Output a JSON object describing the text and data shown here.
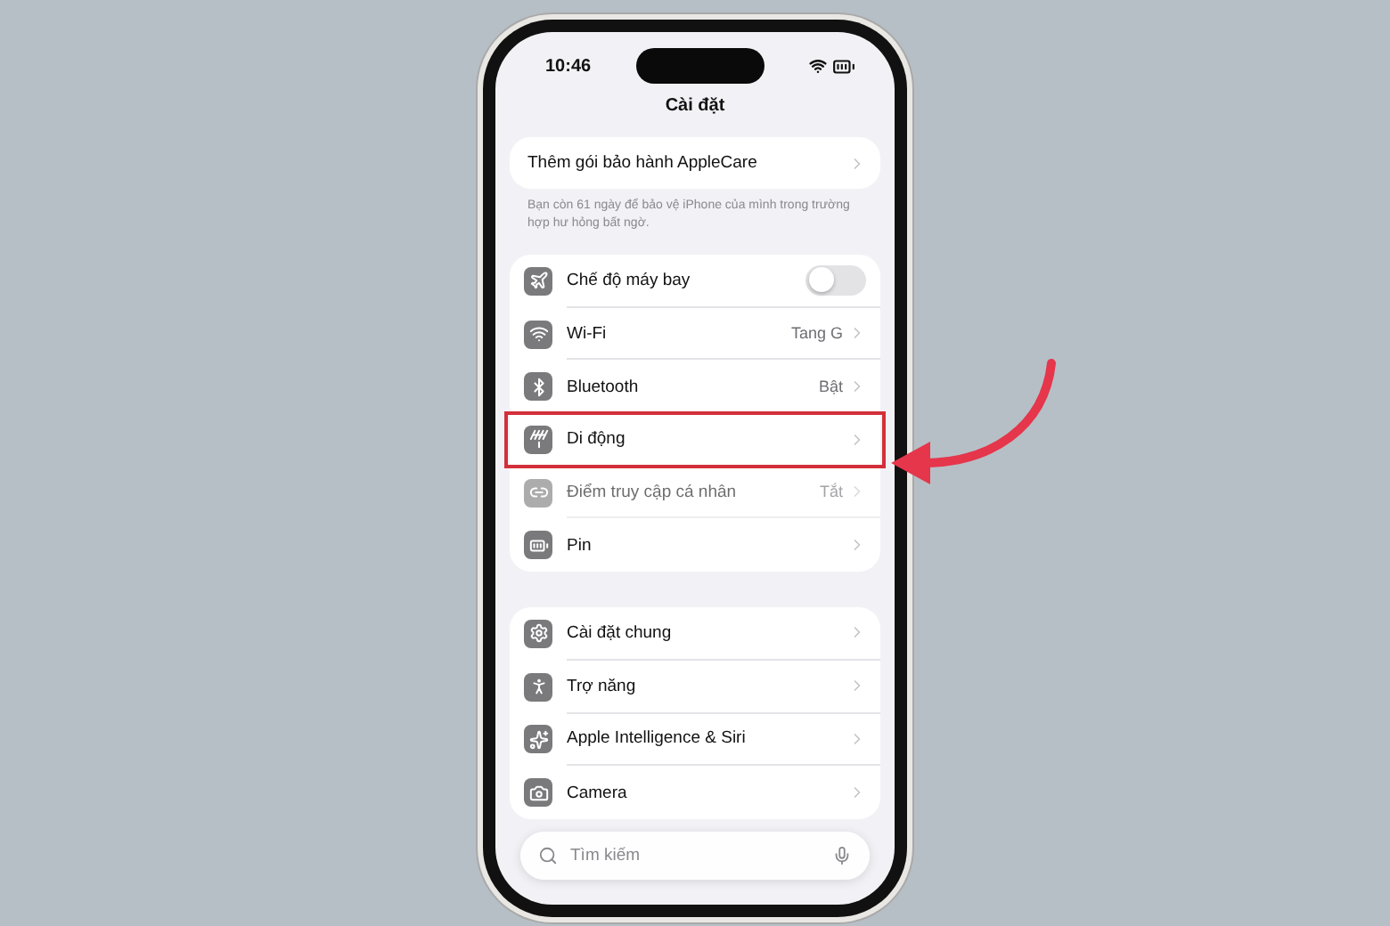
{
  "status_bar": {
    "time": "10:46"
  },
  "title": "Cài đặt",
  "applecare": {
    "label": "Thêm gói bảo hành AppleCare",
    "note": "Bạn còn 61 ngày để bảo vệ iPhone của mình trong trường hợp hư hỏng bất ngờ."
  },
  "groups": [
    {
      "rows": [
        {
          "kind": "toggle",
          "label": "Chế độ máy bay",
          "on": false,
          "highlighted": false,
          "dimmed": false
        },
        {
          "kind": "link",
          "label": "Wi-Fi",
          "value": "Tang G",
          "highlighted": false,
          "dimmed": false
        },
        {
          "kind": "link",
          "label": "Bluetooth",
          "value": "Bật",
          "highlighted": false,
          "dimmed": false
        },
        {
          "kind": "link",
          "label": "Di động",
          "highlighted": true,
          "dimmed": false
        },
        {
          "kind": "link",
          "label": "Điểm truy cập cá nhân",
          "value": "Tắt",
          "highlighted": false,
          "dimmed": true
        },
        {
          "kind": "link",
          "label": "Pin",
          "highlighted": false,
          "dimmed": false
        }
      ]
    },
    {
      "rows": [
        {
          "kind": "link",
          "label": "Cài đặt chung",
          "highlighted": false,
          "dimmed": false
        },
        {
          "kind": "link",
          "label": "Trợ năng",
          "highlighted": false,
          "dimmed": false
        },
        {
          "kind": "link",
          "label": "Apple Intelligence & Siri",
          "highlighted": false,
          "dimmed": false
        },
        {
          "kind": "link",
          "label": "Camera",
          "highlighted": false,
          "dimmed": false
        }
      ]
    }
  ],
  "search": {
    "placeholder": "Tìm kiếm"
  }
}
